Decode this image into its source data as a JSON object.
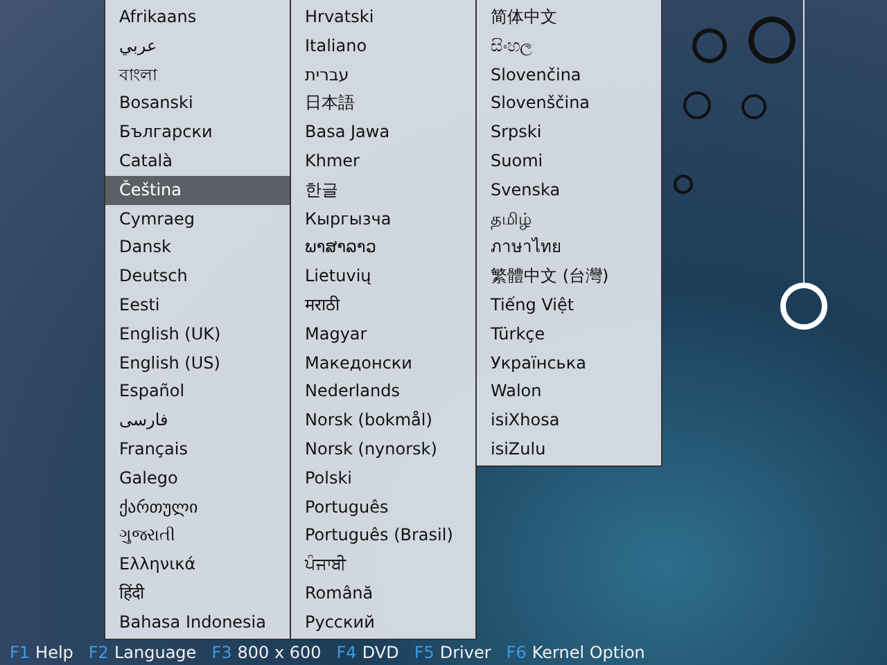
{
  "language_menu": {
    "columns": [
      [
        {
          "label": "Afrikaans",
          "selected": false
        },
        {
          "label": "عربي",
          "selected": false
        },
        {
          "label": "বাংলা",
          "selected": false
        },
        {
          "label": "Bosanski",
          "selected": false
        },
        {
          "label": "Български",
          "selected": false
        },
        {
          "label": "Català",
          "selected": false
        },
        {
          "label": "Čeština",
          "selected": true
        },
        {
          "label": "Cymraeg",
          "selected": false
        },
        {
          "label": "Dansk",
          "selected": false
        },
        {
          "label": "Deutsch",
          "selected": false
        },
        {
          "label": "Eesti",
          "selected": false
        },
        {
          "label": "English (UK)",
          "selected": false
        },
        {
          "label": "English (US)",
          "selected": false
        },
        {
          "label": "Español",
          "selected": false
        },
        {
          "label": "فارسی",
          "selected": false
        },
        {
          "label": "Français",
          "selected": false
        },
        {
          "label": "Galego",
          "selected": false
        },
        {
          "label": "ქართული",
          "selected": false
        },
        {
          "label": "ગુજરાતી",
          "selected": false
        },
        {
          "label": "Ελληνικά",
          "selected": false
        },
        {
          "label": "हिंदी",
          "selected": false
        },
        {
          "label": "Bahasa Indonesia",
          "selected": false
        }
      ],
      [
        {
          "label": "Hrvatski",
          "selected": false
        },
        {
          "label": "Italiano",
          "selected": false
        },
        {
          "label": "עברית",
          "selected": false
        },
        {
          "label": "日本語",
          "selected": false
        },
        {
          "label": "Basa Jawa",
          "selected": false
        },
        {
          "label": "Khmer",
          "selected": false
        },
        {
          "label": "한글",
          "selected": false
        },
        {
          "label": "Кыргызча",
          "selected": false
        },
        {
          "label": "ພາສາລາວ",
          "selected": false
        },
        {
          "label": "Lietuvių",
          "selected": false
        },
        {
          "label": "मराठी",
          "selected": false
        },
        {
          "label": "Magyar",
          "selected": false
        },
        {
          "label": "Македонски",
          "selected": false
        },
        {
          "label": "Nederlands",
          "selected": false
        },
        {
          "label": "Norsk (bokmål)",
          "selected": false
        },
        {
          "label": "Norsk (nynorsk)",
          "selected": false
        },
        {
          "label": "Polski",
          "selected": false
        },
        {
          "label": "Português",
          "selected": false
        },
        {
          "label": "Português (Brasil)",
          "selected": false
        },
        {
          "label": "ਪੰਜਾਬੀ",
          "selected": false
        },
        {
          "label": "Română",
          "selected": false
        },
        {
          "label": "Русский",
          "selected": false
        }
      ],
      [
        {
          "label": "简体中文",
          "selected": false
        },
        {
          "label": "සිංහල",
          "selected": false
        },
        {
          "label": "Slovenčina",
          "selected": false
        },
        {
          "label": "Slovenščina",
          "selected": false
        },
        {
          "label": "Srpski",
          "selected": false
        },
        {
          "label": "Suomi",
          "selected": false
        },
        {
          "label": "Svenska",
          "selected": false
        },
        {
          "label": "தமிழ்",
          "selected": false
        },
        {
          "label": "ภาษาไทย",
          "selected": false
        },
        {
          "label": "繁體中文 (台灣)",
          "selected": false
        },
        {
          "label": "Tiếng Việt",
          "selected": false
        },
        {
          "label": "Türkçe",
          "selected": false
        },
        {
          "label": "Українська",
          "selected": false
        },
        {
          "label": "Walon",
          "selected": false
        },
        {
          "label": "isiXhosa",
          "selected": false
        },
        {
          "label": "isiZulu",
          "selected": false
        }
      ]
    ]
  },
  "function_keys": [
    {
      "key": "F1",
      "label": "Help"
    },
    {
      "key": "F2",
      "label": "Language"
    },
    {
      "key": "F3",
      "label": "800 x 600"
    },
    {
      "key": "F4",
      "label": "DVD"
    },
    {
      "key": "F5",
      "label": "Driver"
    },
    {
      "key": "F6",
      "label": "Kernel Option"
    }
  ]
}
